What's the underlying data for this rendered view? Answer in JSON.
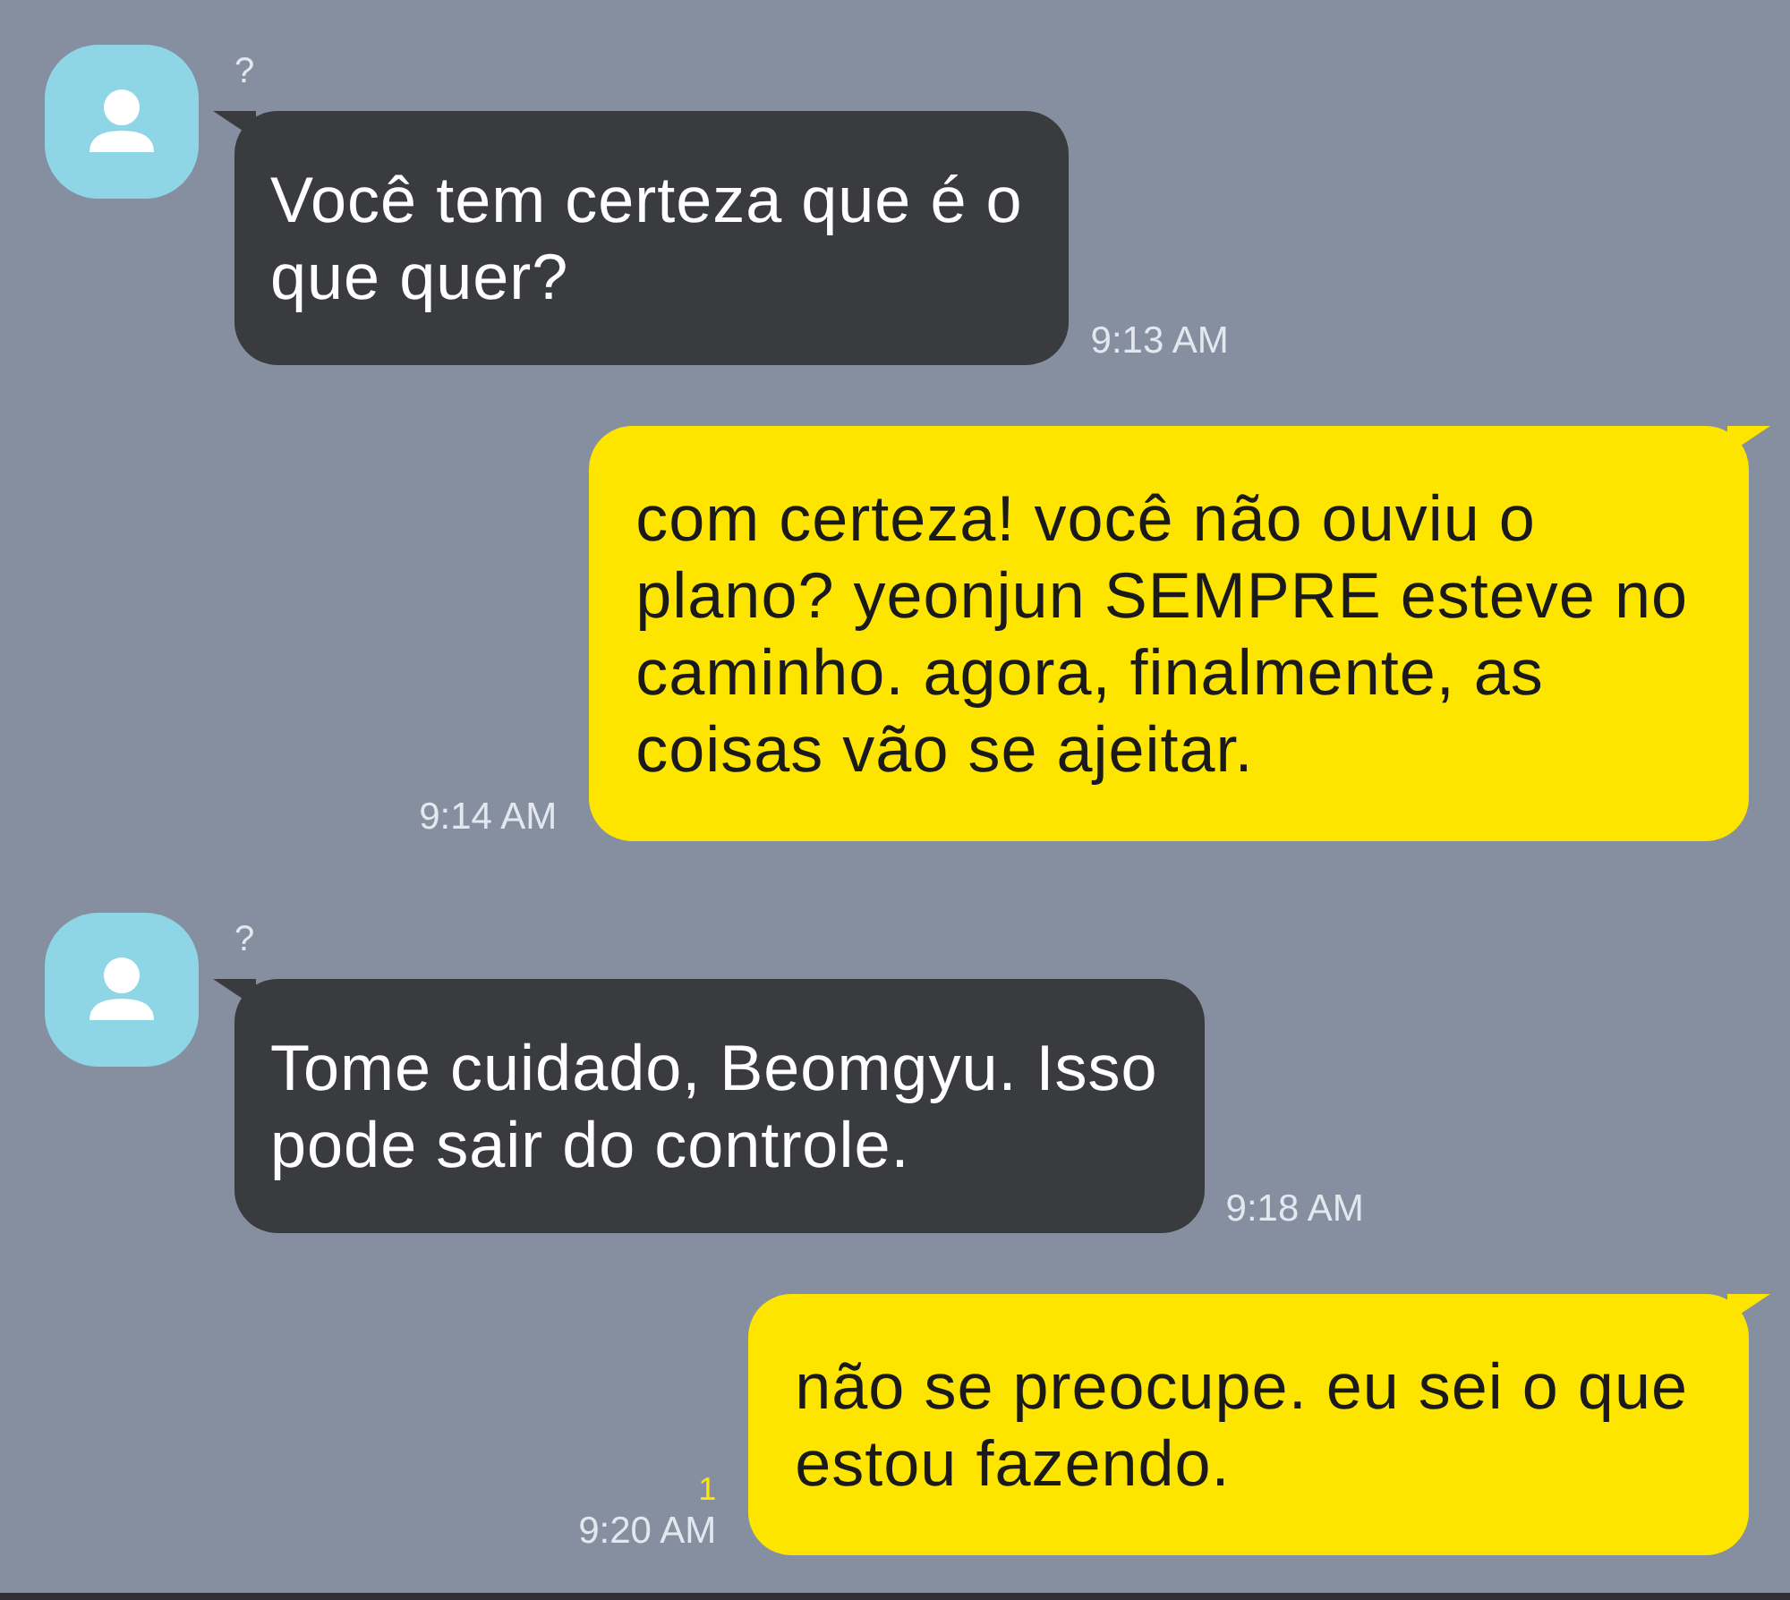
{
  "messages": [
    {
      "kind": "incoming",
      "sender": "?",
      "text": "Você tem certeza que é o\nque quer?",
      "time": "9:13 AM"
    },
    {
      "kind": "outgoing",
      "text": "com certeza! você não ouviu o\nplano? yeonjun SEMPRE esteve no\ncaminho. agora, finalmente, as\ncoisas vão se ajeitar.",
      "time": "9:14 AM"
    },
    {
      "kind": "incoming",
      "sender": "?",
      "text": "Tome cuidado, Beomgyu. Isso\npode sair do controle.",
      "time": "9:18 AM"
    },
    {
      "kind": "outgoing",
      "unread": "1",
      "text": "não se preocupe. eu sei o que\nestou fazendo.",
      "time": "9:20 AM"
    }
  ]
}
